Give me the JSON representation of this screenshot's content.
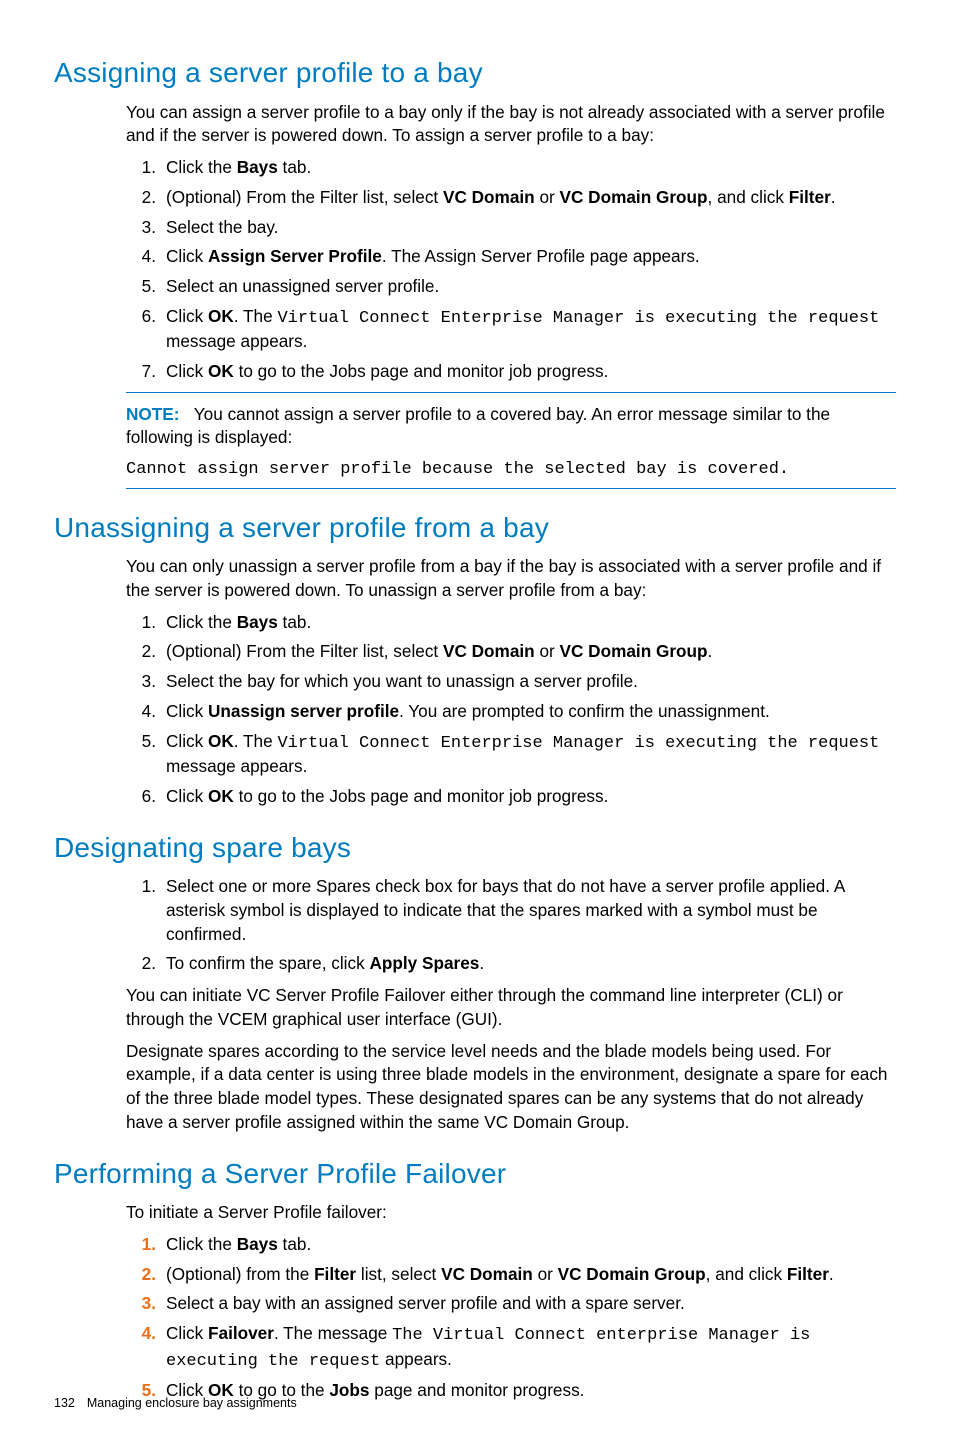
{
  "footer": {
    "page_number": "132",
    "section_title": "Managing enclosure bay assignments"
  },
  "s1": {
    "heading": "Assigning a server profile to a bay",
    "intro": "You can assign a server profile to a bay only if the bay is not already associated with a server profile and if the server is powered down. To assign a server profile to a bay:",
    "steps": {
      "i1_pre": "Click the ",
      "i1_b": "Bays",
      "i1_post": " tab.",
      "i2_pre": "(Optional) From the Filter list, select ",
      "i2_b1": "VC Domain",
      "i2_mid": " or ",
      "i2_b2": "VC Domain Group",
      "i2_mid2": ", and click ",
      "i2_b3": "Filter",
      "i2_post": ".",
      "i3": "Select the bay.",
      "i4_pre": "Click ",
      "i4_b": "Assign Server Profile",
      "i4_post": ". The Assign Server Profile page appears.",
      "i5": "Select an unassigned server profile.",
      "i6_pre": "Click ",
      "i6_b": "OK",
      "i6_mid": ". The ",
      "i6_code": "Virtual Connect Enterprise Manager is executing the request",
      "i6_post": " message appears.",
      "i7_pre": "Click ",
      "i7_b": "OK",
      "i7_post": " to go to the Jobs page and monitor job progress."
    },
    "note": {
      "label": "NOTE:",
      "text": "You cannot assign a server profile to a covered bay. An error message similar to the following is displayed:",
      "code": "Cannot assign server profile because the selected bay is covered."
    }
  },
  "s2": {
    "heading": "Unassigning a server profile from a bay",
    "intro": "You can only unassign a server profile from a bay if the bay is associated with a server profile and if the server is powered down. To unassign a server profile from a bay:",
    "steps": {
      "i1_pre": "Click the ",
      "i1_b": "Bays",
      "i1_post": " tab.",
      "i2_pre": "(Optional) From the Filter list, select ",
      "i2_b1": "VC Domain",
      "i2_mid": " or ",
      "i2_b2": "VC Domain Group",
      "i2_post": ".",
      "i3": "Select the bay for which you want to unassign a server profile.",
      "i4_pre": "Click ",
      "i4_b": "Unassign server profile",
      "i4_post": ". You are prompted to confirm the unassignment.",
      "i5_pre": "Click ",
      "i5_b": "OK",
      "i5_mid": ". The ",
      "i5_code": "Virtual Connect Enterprise Manager is executing the request",
      "i5_post": " message appears.",
      "i6_pre": "Click ",
      "i6_b": "OK",
      "i6_post": " to go to the Jobs page and monitor job progress."
    }
  },
  "s3": {
    "heading": "Designating spare bays",
    "steps": {
      "i1": "Select one or more Spares check box for bays that do not have a server profile applied. A asterisk symbol is displayed to indicate that the spares marked with a symbol must be confirmed.",
      "i2_pre": "To confirm the spare, click ",
      "i2_b": "Apply Spares",
      "i2_post": "."
    },
    "p1": "You can initiate VC Server Profile Failover either through the command line interpreter (CLI) or through the VCEM graphical user interface (GUI).",
    "p2": "Designate spares according to the service level needs and the blade models being used. For example, if a data center is using three blade models in the environment, designate a spare for each of the three blade model types. These designated spares can be any systems that do not already have a server profile assigned within the same VC Domain Group."
  },
  "s4": {
    "heading": "Performing a Server Profile Failover",
    "intro": "To initiate a Server Profile failover:",
    "steps": {
      "i1_pre": "Click the ",
      "i1_b": "Bays",
      "i1_post": " tab.",
      "i2_pre": "(Optional) from the ",
      "i2_b1": "Filter",
      "i2_mid1": " list, select ",
      "i2_b2": "VC Domain",
      "i2_mid2": " or ",
      "i2_b3": "VC Domain Group",
      "i2_mid3": ", and click ",
      "i2_b4": "Filter",
      "i2_post": ".",
      "i3": "Select a bay with an assigned server profile and with a spare server.",
      "i4_pre": "Click ",
      "i4_b": "Failover",
      "i4_mid": ". The message ",
      "i4_code": "The Virtual Connect enterprise Manager is executing the request",
      "i4_post": " appears.",
      "i5_pre": "Click ",
      "i5_b1": "OK",
      "i5_mid": " to go to the ",
      "i5_b2": "Jobs",
      "i5_post": " page and monitor progress."
    }
  }
}
